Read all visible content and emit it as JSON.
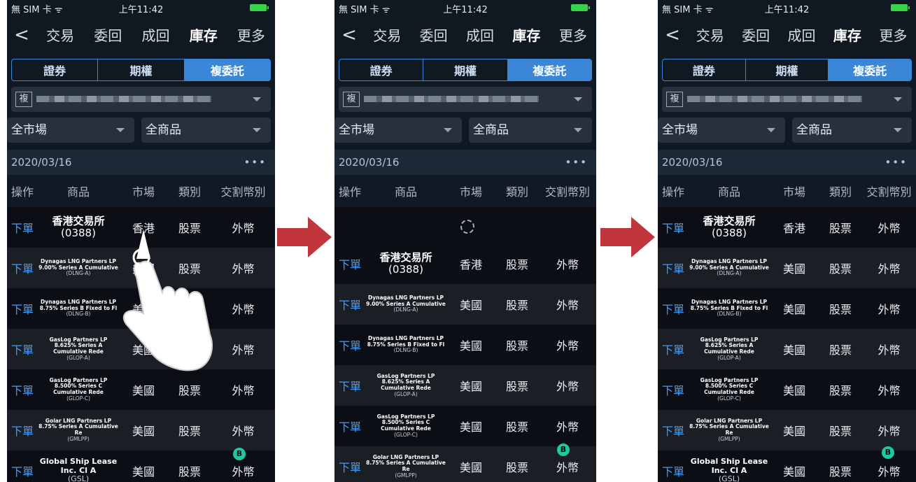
{
  "status": {
    "carrier": "無 SIM 卡 ᯤ",
    "time": "上午11:42"
  },
  "nav": {
    "back": "<",
    "items": [
      "交易",
      "委回",
      "成回",
      "庫存",
      "更多"
    ],
    "active_index": 3
  },
  "segments": {
    "items": [
      "證券",
      "期權",
      "複委託"
    ],
    "active_index": 2
  },
  "account": {
    "tag": "複"
  },
  "filters": {
    "market": "全市場",
    "product": "全商品"
  },
  "date": "2020/03/16",
  "more_dots": "•••",
  "table": {
    "headers": [
      "操作",
      "商品",
      "市場",
      "類別",
      "交割幣別"
    ],
    "rows": [
      {
        "action": "下單",
        "name": "香港交易所",
        "code": "(0388)",
        "market": "香港",
        "type": "股票",
        "currency": "外幣",
        "size": "big"
      },
      {
        "action": "下單",
        "name": "Dynagas LNG Partners LP 9.00% Series A Cumulative",
        "code": "(DLNG-A)",
        "market": "美國",
        "type": "股票",
        "currency": "外幣",
        "size": "small"
      },
      {
        "action": "下單",
        "name": "Dynagas LNG Partners LP 8.75% Series B Fixed to Fl",
        "code": "(DLNG-B)",
        "market": "美國",
        "type": "股票",
        "currency": "外幣",
        "size": "small"
      },
      {
        "action": "下單",
        "name": "GasLog Partners LP 8.625% Series A Cumulative Rede",
        "code": "(GLOP-A)",
        "market": "美國",
        "type": "股票",
        "currency": "外幣",
        "size": "small"
      },
      {
        "action": "下單",
        "name": "GasLog Partners LP 8.500% Series C Cumulative Rede",
        "code": "(GLOP-C)",
        "market": "美國",
        "type": "股票",
        "currency": "外幣",
        "size": "small"
      },
      {
        "action": "下單",
        "name": "Golar LNG Partners LP 8.75% Series A Cumulative Re",
        "code": "(GMLPP)",
        "market": "美國",
        "type": "股票",
        "currency": "外幣",
        "size": "small"
      },
      {
        "action": "下單",
        "name": "Global Ship Lease Inc. Cl A",
        "code": "(GSL)",
        "market": "美國",
        "type": "股票",
        "currency": "外幣",
        "size": "mid"
      }
    ]
  },
  "badge_icon": "chat-bubble-icon",
  "badge_text": "B",
  "colors": {
    "accent": "#3c86d8",
    "action": "#4b9bef",
    "arrow": "#c0363c",
    "badge": "#1fc9a0"
  }
}
